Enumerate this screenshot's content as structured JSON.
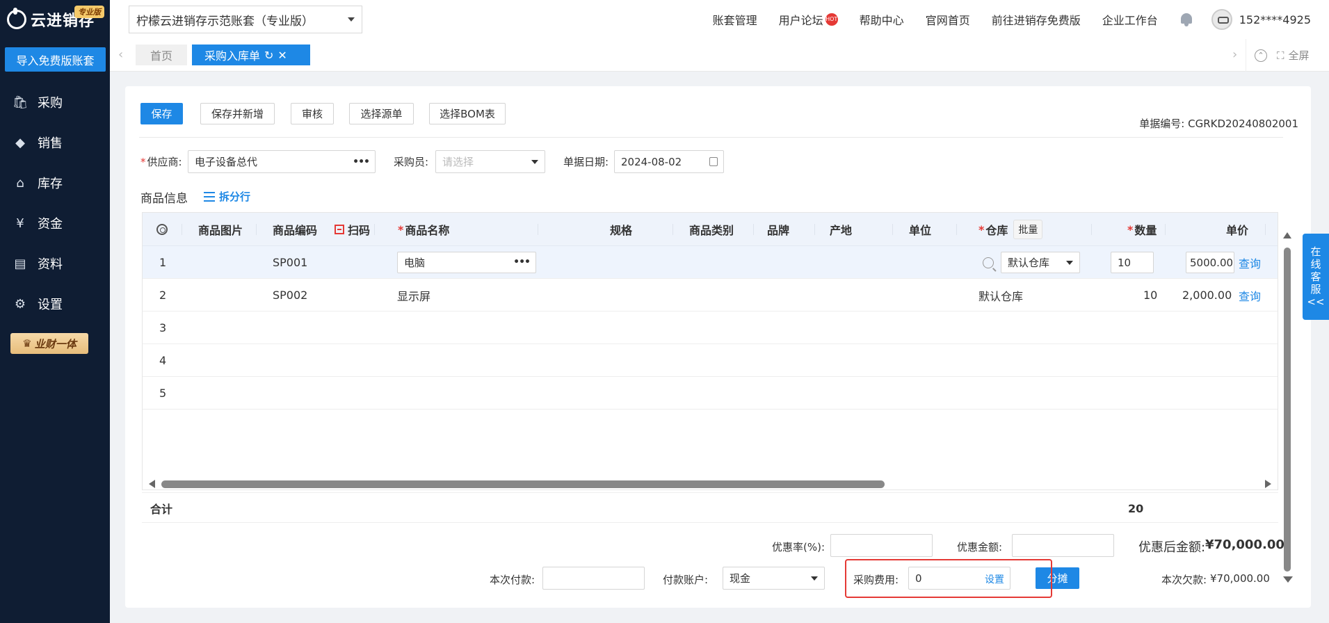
{
  "sidebar": {
    "logo_text": "云进销存",
    "pro_badge": "专业版",
    "import_button": "导入免费版账套",
    "items": [
      {
        "label": "采购",
        "icon": "bag-icon"
      },
      {
        "label": "销售",
        "icon": "sales-icon"
      },
      {
        "label": "库存",
        "icon": "warehouse-icon"
      },
      {
        "label": "资金",
        "icon": "yen-icon"
      },
      {
        "label": "资料",
        "icon": "document-icon"
      },
      {
        "label": "设置",
        "icon": "gear-icon"
      }
    ],
    "promo": "业财一体"
  },
  "topbar": {
    "account_name": "柠檬云进销存示范账套（专业版）",
    "links": {
      "account_mgmt": "账套管理",
      "forum": "用户论坛",
      "forum_badge": "HOT",
      "help": "帮助中心",
      "website": "官网首页",
      "free_version": "前往进销存免费版",
      "workbench": "企业工作台"
    },
    "phone": "152****4925"
  },
  "tabs": {
    "home": "首页",
    "active": "采购入库单",
    "fullscreen": "全屏"
  },
  "toolbar": {
    "save": "保存",
    "save_new": "保存并新增",
    "audit": "审核",
    "select_source": "选择源单",
    "select_bom": "选择BOM表",
    "doc_no_label": "单据编号: ",
    "doc_no": "CGRKD20240802001"
  },
  "form": {
    "supplier_label": "供应商:",
    "supplier_value": "电子设备总代",
    "buyer_label": "采购员:",
    "buyer_placeholder": "请选择",
    "date_label": "单据日期:",
    "date_value": "2024-08-02"
  },
  "goods": {
    "section_title": "商品信息",
    "split_rows": "拆分行",
    "columns": {
      "image": "商品图片",
      "code": "商品编码",
      "scan": "扫码",
      "name": "商品名称",
      "spec": "规格",
      "category": "商品类别",
      "brand": "品牌",
      "origin": "产地",
      "unit": "单位",
      "warehouse": "仓库",
      "batch": "批量",
      "qty": "数量",
      "price": "单价"
    },
    "rows": [
      {
        "no": "1",
        "code": "SP001",
        "name": "电脑",
        "warehouse": "默认仓库",
        "qty": "10",
        "price": "5000.00",
        "query": "查询"
      },
      {
        "no": "2",
        "code": "SP002",
        "name": "显示屏",
        "warehouse": "默认仓库",
        "qty": "10",
        "price": "2,000.00",
        "query": "查询"
      },
      {
        "no": "3"
      },
      {
        "no": "4"
      },
      {
        "no": "5"
      }
    ],
    "total_label": "合计",
    "total_qty": "20"
  },
  "footer": {
    "discount_rate_label": "优惠率(%):",
    "discount_amount_label": "优惠金额:",
    "after_discount_label": "优惠后金额:",
    "after_discount_value": "¥70,000.00",
    "payment_label": "本次付款:",
    "account_label": "付款账户:",
    "account_value": "现金",
    "purchase_fee_label": "采购费用:",
    "purchase_fee_value": "0",
    "set_link": "设置",
    "allocate_button": "分摊",
    "debt_label": "本次欠款:",
    "debt_value": "¥70,000.00"
  },
  "chat": {
    "chars": [
      "在",
      "线",
      "客",
      "服"
    ],
    "arrow": "<<"
  }
}
